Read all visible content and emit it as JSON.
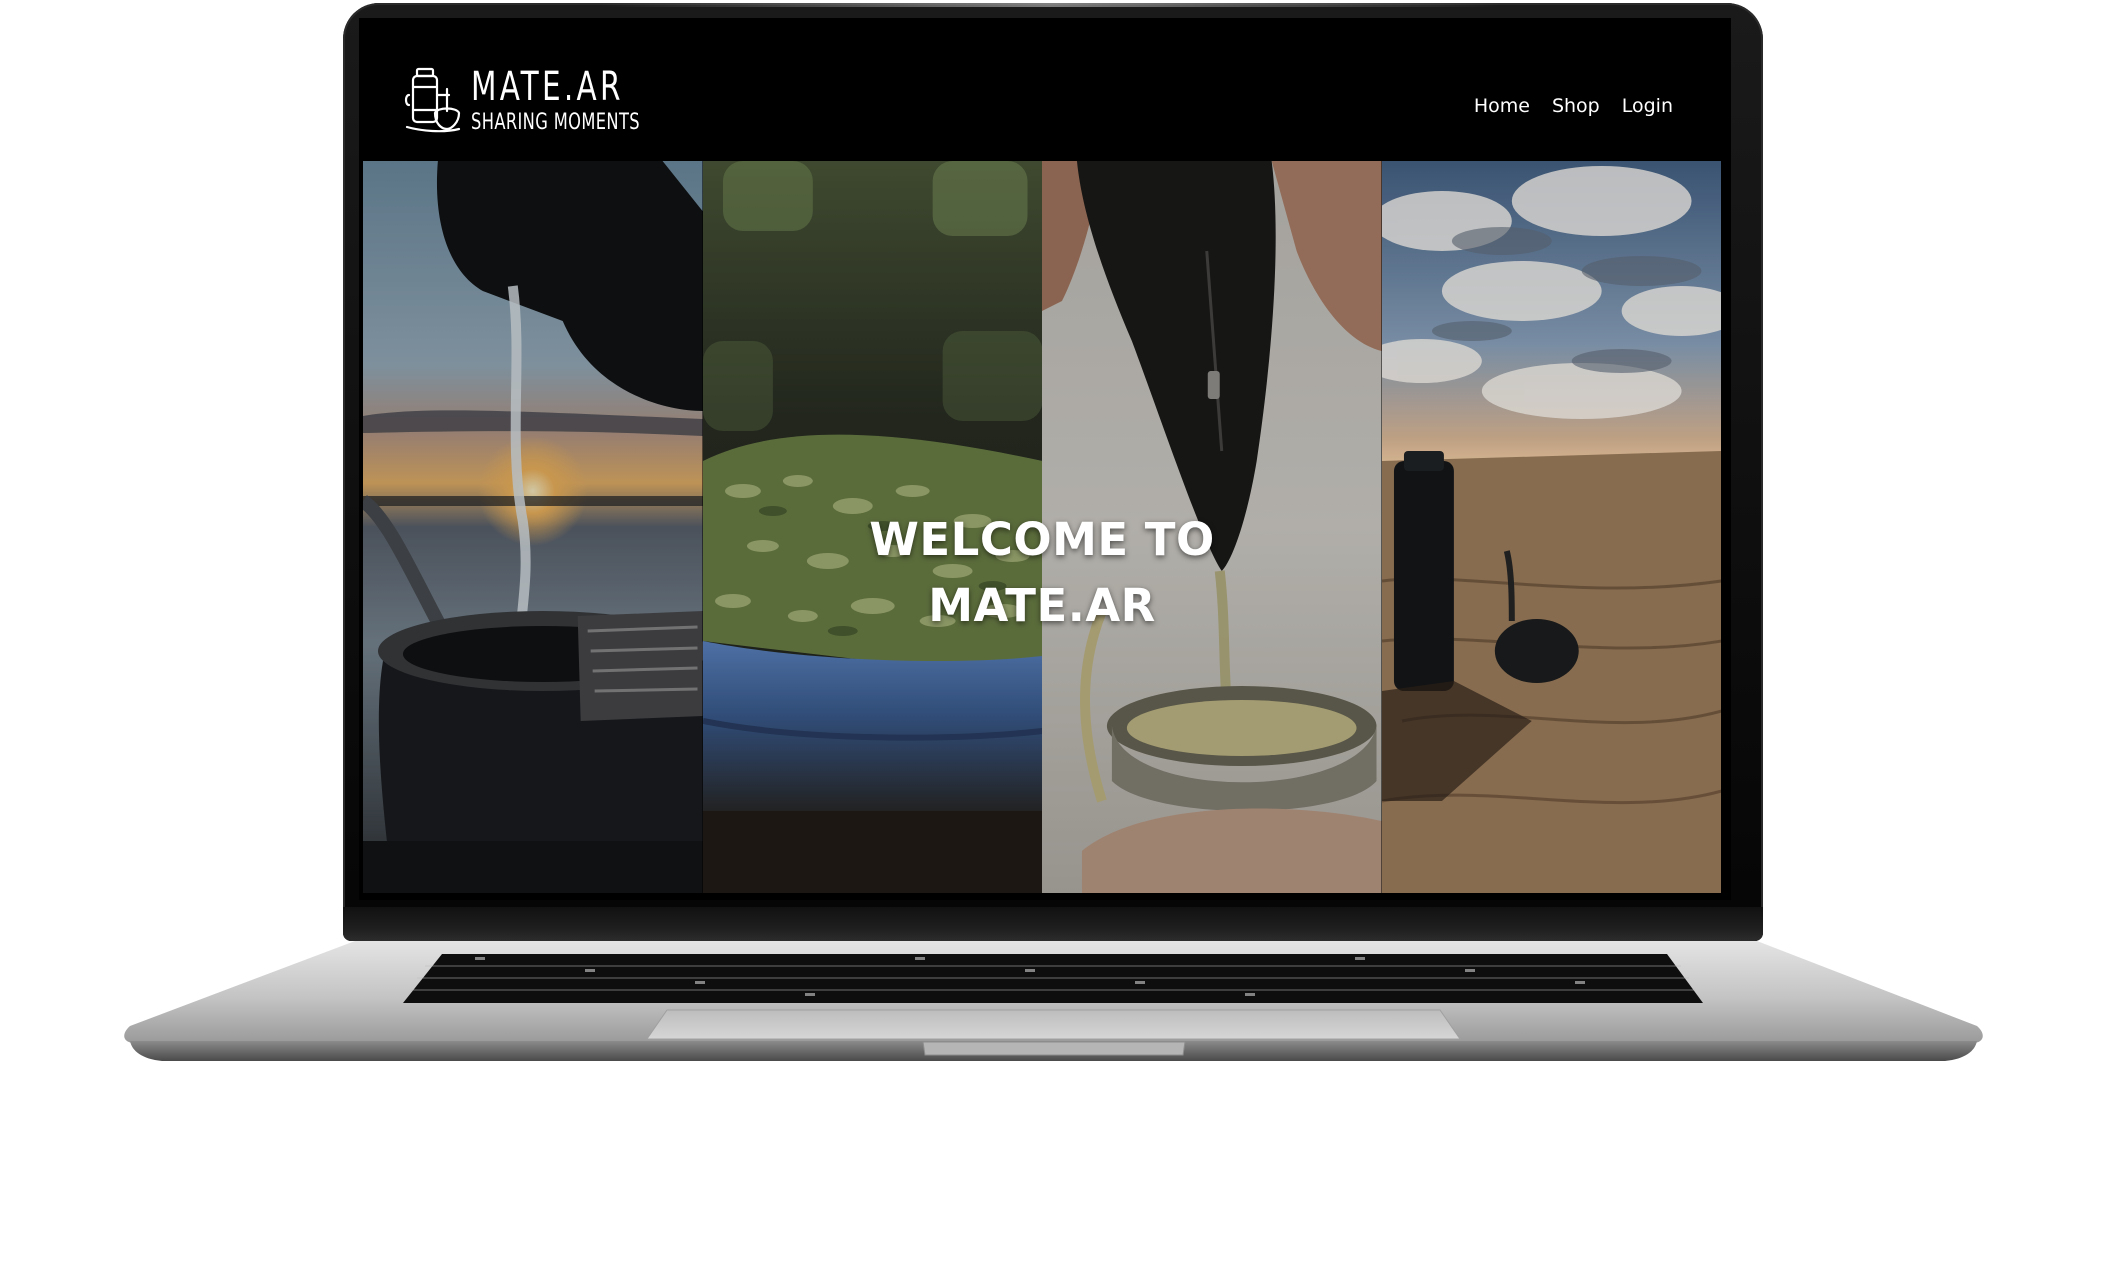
{
  "site": {
    "logo_title": "MATE.AR",
    "logo_subtitle": "SHARING MOMENTS",
    "logo_icon": "mate-thermos-icon"
  },
  "nav": {
    "items": [
      {
        "label": "Home"
      },
      {
        "label": "Shop"
      },
      {
        "label": "Login"
      }
    ]
  },
  "hero": {
    "title_line1": "WELCOME TO",
    "title_line2": "MATE.AR",
    "panels": [
      {
        "name": "hero-image-pouring-water"
      },
      {
        "name": "hero-image-yerba-leaves"
      },
      {
        "name": "hero-image-pouring-yerba"
      },
      {
        "name": "hero-image-beach-thermos"
      }
    ]
  },
  "colors": {
    "header_bg": "#000000",
    "text": "#ffffff",
    "laptop_bezel": "#0a0a0a",
    "laptop_body": "#c8c8c8"
  }
}
